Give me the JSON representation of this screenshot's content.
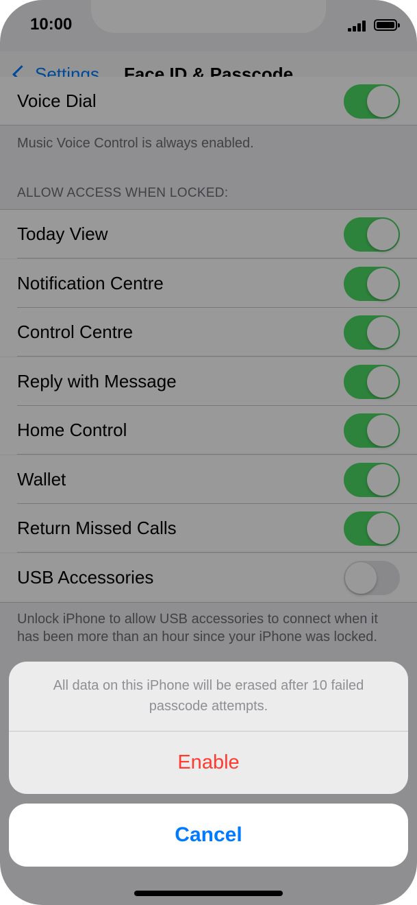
{
  "status_bar": {
    "time": "10:00"
  },
  "nav": {
    "back_label": "Settings",
    "title": "Face ID & Passcode"
  },
  "voice_dial": {
    "label": "Voice Dial",
    "on": true
  },
  "voice_footer": "Music Voice Control is always enabled.",
  "locked_section": {
    "header": "ALLOW ACCESS WHEN LOCKED:",
    "items": [
      {
        "label": "Today View",
        "on": true
      },
      {
        "label": "Notification Centre",
        "on": true
      },
      {
        "label": "Control Centre",
        "on": true
      },
      {
        "label": "Reply with Message",
        "on": true
      },
      {
        "label": "Home Control",
        "on": true
      },
      {
        "label": "Wallet",
        "on": true
      },
      {
        "label": "Return Missed Calls",
        "on": true
      },
      {
        "label": "USB Accessories",
        "on": false
      }
    ],
    "footer": "Unlock iPhone to allow USB accessories to connect when it has been more than an hour since your iPhone was locked."
  },
  "action_sheet": {
    "message": "All data on this iPhone will be erased after 10 failed passcode attempts.",
    "enable_label": "Enable",
    "cancel_label": "Cancel"
  },
  "colors": {
    "toggle_on": "#4cd964",
    "destructive": "#ff3b30",
    "accent": "#007aff"
  }
}
